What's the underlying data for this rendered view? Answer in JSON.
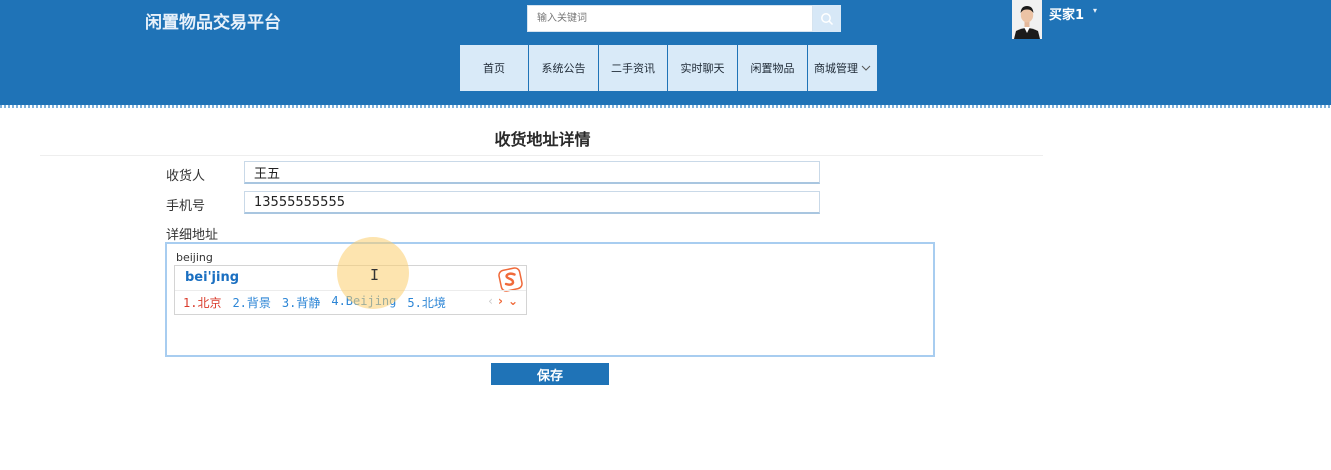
{
  "header": {
    "brand": "闲置物品交易平台",
    "search_placeholder": "输入关键词",
    "user_name": "买家1",
    "user_caret": "▾"
  },
  "nav": {
    "items": [
      {
        "label": "首页"
      },
      {
        "label": "系统公告"
      },
      {
        "label": "二手资讯"
      },
      {
        "label": "实时聊天"
      },
      {
        "label": "闲置物品"
      },
      {
        "label": "商城管理"
      }
    ]
  },
  "page": {
    "title": "收货地址详情"
  },
  "form": {
    "recipient_label": "收货人",
    "recipient_value": "王五",
    "phone_label": "手机号",
    "phone_value": "13555555555",
    "address_label": "详细地址",
    "address_typed": "beijing",
    "save_label": "保存"
  },
  "ime": {
    "composition": "bei'jing",
    "candidates": [
      "1.北京",
      "2.背景",
      "3.背静",
      "4.Beijing",
      "5.北境"
    ],
    "prev": "‹",
    "next": "›",
    "more": "⌄"
  },
  "colors": {
    "header_bg": "#1f73b7",
    "nav_bg": "#d9eaf8",
    "accent_link": "#2d86d6",
    "ime_highlight": "#d93a2a",
    "ime_logo": "#f06a3a"
  }
}
